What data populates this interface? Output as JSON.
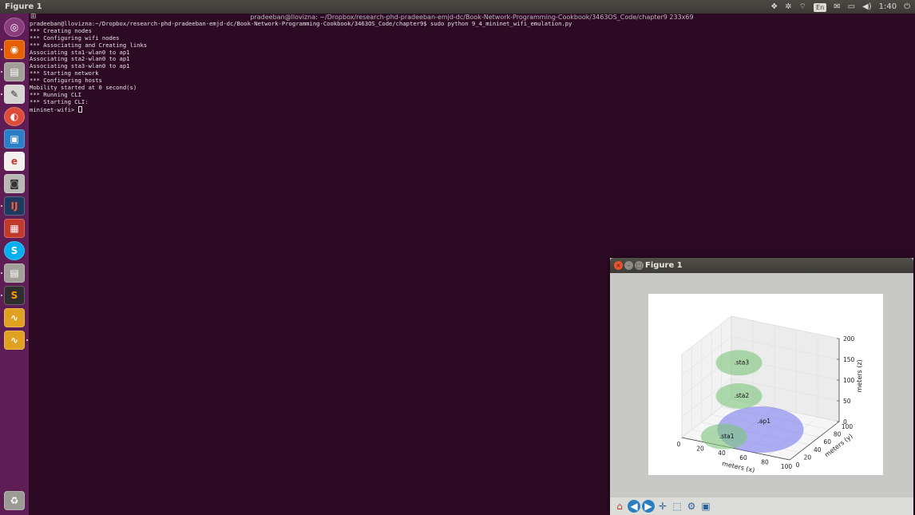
{
  "topbar": {
    "app_title": "Figure 1",
    "language": "En",
    "time": "1:40"
  },
  "terminal": {
    "title": "pradeeban@llovizna: ~/Dropbox/research-phd-pradeeban-emjd-dc/Book-Network-Programming-Cookbook/3463OS_Code/chapter9 233x69",
    "prompt_line": "pradeeban@llovizna:~/Dropbox/research-phd-pradeeban-emjd-dc/Book-Network-Programming-Cookbook/3463OS_Code/chapter9$ sudo python 9_4_mininet_wifi_emulation.py",
    "lines": [
      "*** Creating nodes",
      "*** Configuring wifi nodes",
      "*** Associating and Creating links",
      "Associating sta1-wlan0 to ap1",
      "Associating sta2-wlan0 to ap1",
      "Associating sta3-wlan0 to ap1",
      "*** Starting network",
      "*** Configuring hosts",
      "Mobility started at 0 second(s)",
      "*** Running CLI",
      "*** Starting CLI:"
    ],
    "cli_prompt": "mininet-wifi> "
  },
  "figure_window": {
    "title": "Figure 1",
    "toolbar": [
      "home-icon",
      "back-arrow-icon",
      "forward-arrow-icon",
      "pan-icon",
      "zoom-icon",
      "configure-subplots-icon",
      "save-icon"
    ]
  },
  "launcher": [
    "dash-icon",
    "firefox-icon",
    "files-icon",
    "text-editor-icon",
    "chrome-icon",
    "libreoffice-impress-icon",
    "eclipse-icon",
    "screenshot-icon",
    "intellij-icon",
    "app-icon",
    "skype-icon",
    "files-icon",
    "sublime-icon",
    "waveform-icon",
    "waveform-icon",
    "trash-icon"
  ],
  "chart_data": {
    "type": "scatter",
    "nodes": [
      {
        "name": "sta3",
        "x": 30,
        "y": 50,
        "z": 150,
        "color": "#7cc47c"
      },
      {
        "name": "sta2",
        "x": 30,
        "y": 50,
        "z": 70,
        "color": "#7cc47c"
      },
      {
        "name": "ap1",
        "x": 50,
        "y": 50,
        "z": 0,
        "color": "#7070f0"
      },
      {
        "name": "sta1",
        "x": 30,
        "y": 20,
        "z": 0,
        "color": "#7cc47c"
      }
    ],
    "xlabel": "meters (x)",
    "ylabel": "meters (y)",
    "zlabel": "meters (z)",
    "xticks": [
      "0",
      "20",
      "40",
      "60",
      "80",
      "100"
    ],
    "yticks": [
      "0",
      "20",
      "40",
      "60",
      "80",
      "100"
    ],
    "zticks": [
      "0",
      "50",
      "100",
      "150",
      "200"
    ],
    "xlim": [
      0,
      100
    ],
    "ylim": [
      0,
      100
    ],
    "zlim": [
      0,
      200
    ]
  }
}
